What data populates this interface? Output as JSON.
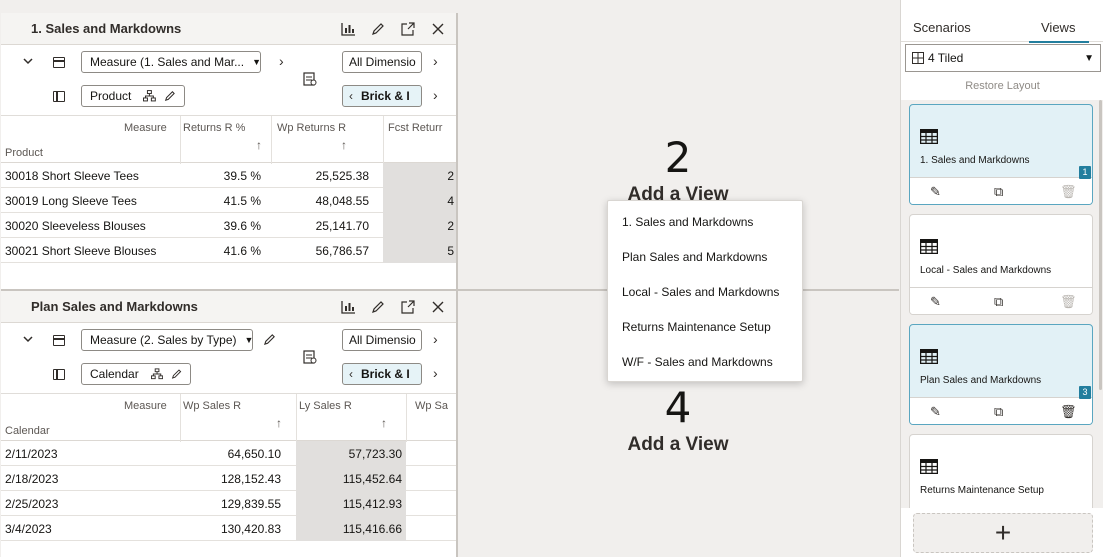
{
  "views": [
    {
      "title": "1. Sales and Markdowns",
      "measure_dd": "Measure (1. Sales and Mar...",
      "row_dim": "Product",
      "all_dim": "All Dimensio",
      "brick": "Brick & I",
      "measure_label": "Measure",
      "row_label": "Product",
      "col_headers": [
        "Returns R %",
        "Wp Returns R",
        "Fcst Returr"
      ],
      "rows": [
        {
          "name": "30018 Short Sleeve Tees",
          "c1": "39.5 %",
          "c2": "25,525.38",
          "c3": "2"
        },
        {
          "name": "30019 Long Sleeve Tees",
          "c1": "41.5 %",
          "c2": "48,048.55",
          "c3": "4"
        },
        {
          "name": "30020 Sleeveless Blouses",
          "c1": "39.6 %",
          "c2": "25,141.70",
          "c3": "2"
        },
        {
          "name": "30021 Short Sleeve Blouses",
          "c1": "41.6 %",
          "c2": "56,786.57",
          "c3": "5"
        }
      ]
    },
    {
      "title": "Plan Sales and Markdowns",
      "measure_dd": "Measure (2. Sales by Type)",
      "row_dim": "Calendar",
      "all_dim": "All Dimensio",
      "brick": "Brick & I",
      "measure_label": "Measure",
      "row_label": "Calendar",
      "col_headers": [
        "Wp Sales R",
        "Ly Sales R",
        "Wp Sa"
      ],
      "rows": [
        {
          "name": "2/11/2023",
          "c1": "64,650.10",
          "c2": "57,723.30"
        },
        {
          "name": "2/18/2023",
          "c1": "128,152.43",
          "c2": "115,452.64"
        },
        {
          "name": "2/25/2023",
          "c1": "129,839.55",
          "c2": "115,412.93"
        },
        {
          "name": "3/4/2023",
          "c1": "130,420.83",
          "c2": "115,416.66"
        }
      ]
    }
  ],
  "empty_slots": [
    {
      "number": "2",
      "label": "Add a View"
    },
    {
      "number": "4",
      "label": "Add a View"
    }
  ],
  "menu": {
    "items": [
      "1. Sales and Markdowns",
      "Plan Sales and Markdowns",
      "Local - Sales and Markdowns",
      "Returns Maintenance Setup",
      "W/F - Sales and Markdowns"
    ]
  },
  "panel": {
    "tabs": [
      "Scenarios",
      "Views"
    ],
    "active_tab": "Views",
    "layout": "4 Tiled",
    "restore": "Restore Layout",
    "cards": [
      {
        "label": "1. Sales and Markdowns",
        "selected": true,
        "badge": "1"
      },
      {
        "label": "Local - Sales and Markdowns",
        "selected": false,
        "badge": ""
      },
      {
        "label": "Plan Sales and Markdowns",
        "selected": true,
        "badge": "3"
      },
      {
        "label": "Returns Maintenance Setup",
        "selected": false,
        "badge": ""
      }
    ],
    "add_symbol": "+"
  },
  "colors": {
    "accent": "#227e9e",
    "selected_card": "#e2f1f6",
    "shaded_cell": "#e1dfdd"
  }
}
